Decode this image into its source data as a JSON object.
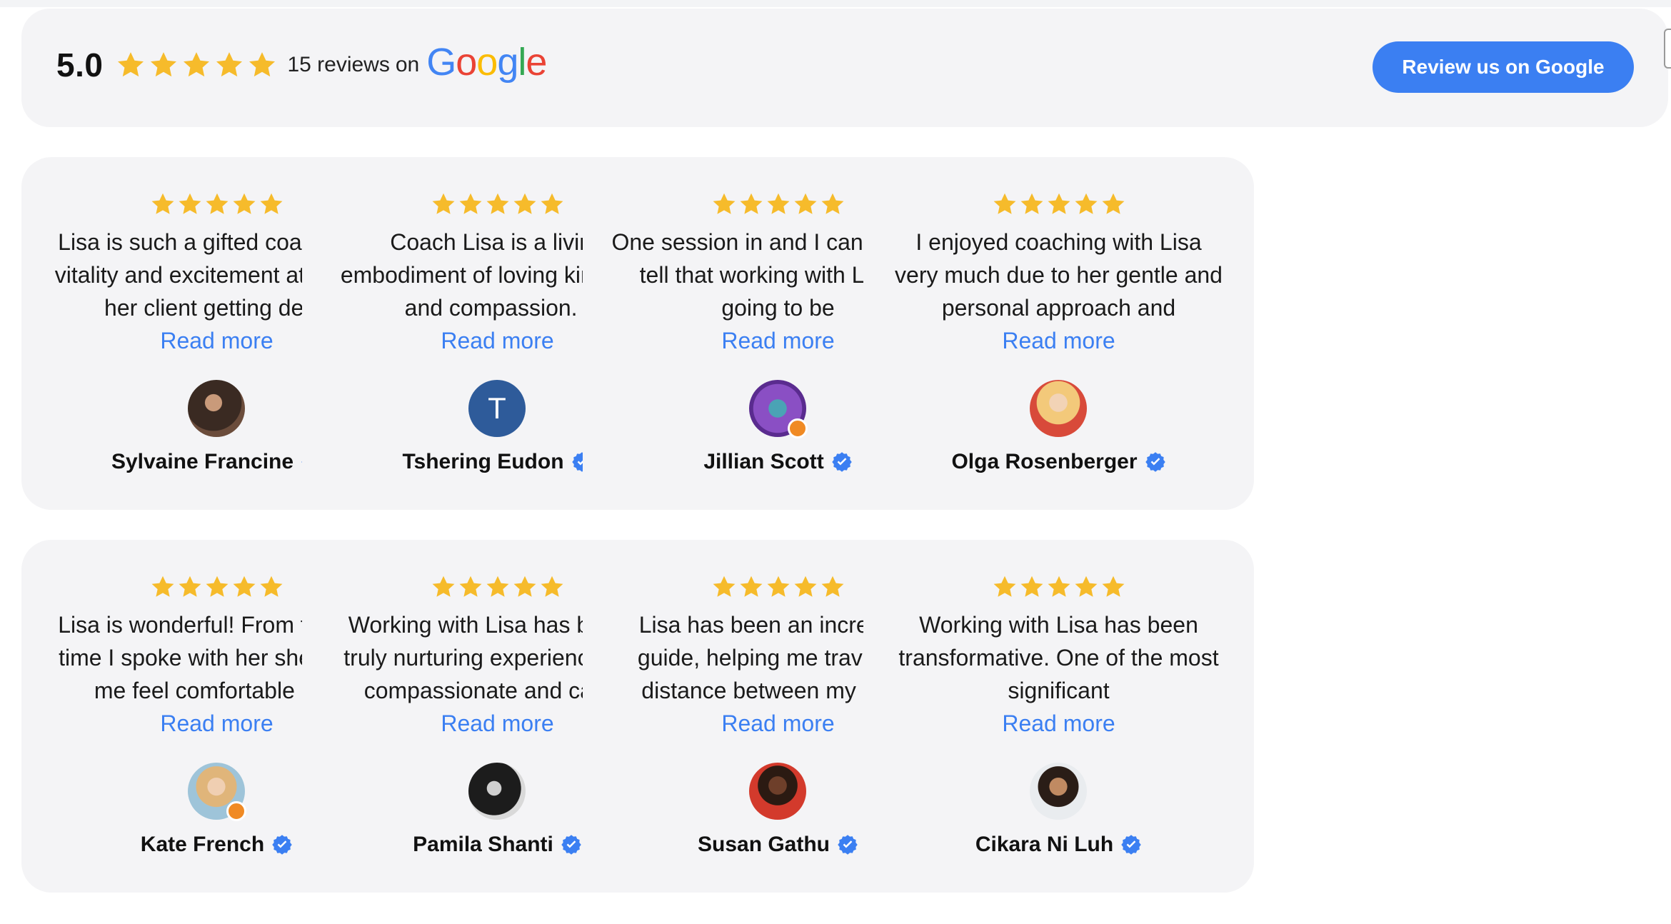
{
  "summary": {
    "rating": "5.0",
    "reviews_text": "15 reviews",
    "on_text": "on",
    "brand": "Google",
    "star_color": "#F6BB2B",
    "accent": "#3B7FF2"
  },
  "header": {
    "review_button_label": "Review us on Google"
  },
  "reviews": [
    {
      "name": "Sylvaine Francine",
      "text": "Lisa is such a gifted coach! Her vitality and excitement at seeing her client getting deep",
      "read_more": "Read more",
      "avatar": "photo",
      "stars": 5
    },
    {
      "name": "Tshering Eudon",
      "text": "Coach Lisa is a living embodiment of loving kindness and compassion. I",
      "read_more": "Read more",
      "avatar": "T",
      "stars": 5
    },
    {
      "name": "Jillian Scott",
      "text": "One session in and I can already tell that working with Lisa is going to be",
      "read_more": "Read more",
      "avatar": "photo",
      "stars": 5
    },
    {
      "name": "Olga Rosenberger",
      "text": "I enjoyed coaching with Lisa very much due to her gentle and personal approach and",
      "read_more": "Read more",
      "avatar": "photo",
      "stars": 5
    },
    {
      "name": "Kate French",
      "text": "Lisa is wonderful! From the first time I spoke with her she made me feel comfortable and",
      "read_more": "Read more",
      "avatar": "photo",
      "stars": 5
    },
    {
      "name": "Pamila Shanti",
      "text": "Working with Lisa has been a truly nurturing experience. Her compassionate and caring",
      "read_more": "Read more",
      "avatar": "photo",
      "stars": 5
    },
    {
      "name": "Susan Gathu",
      "text": "Lisa has been an incredible guide, helping me travel the distance between my heart",
      "read_more": "Read more",
      "avatar": "photo",
      "stars": 5
    },
    {
      "name": "Cikara Ni Luh",
      "text": "Working with Lisa has been transformative. One of the most significant",
      "read_more": "Read more",
      "avatar": "photo",
      "stars": 5
    }
  ]
}
